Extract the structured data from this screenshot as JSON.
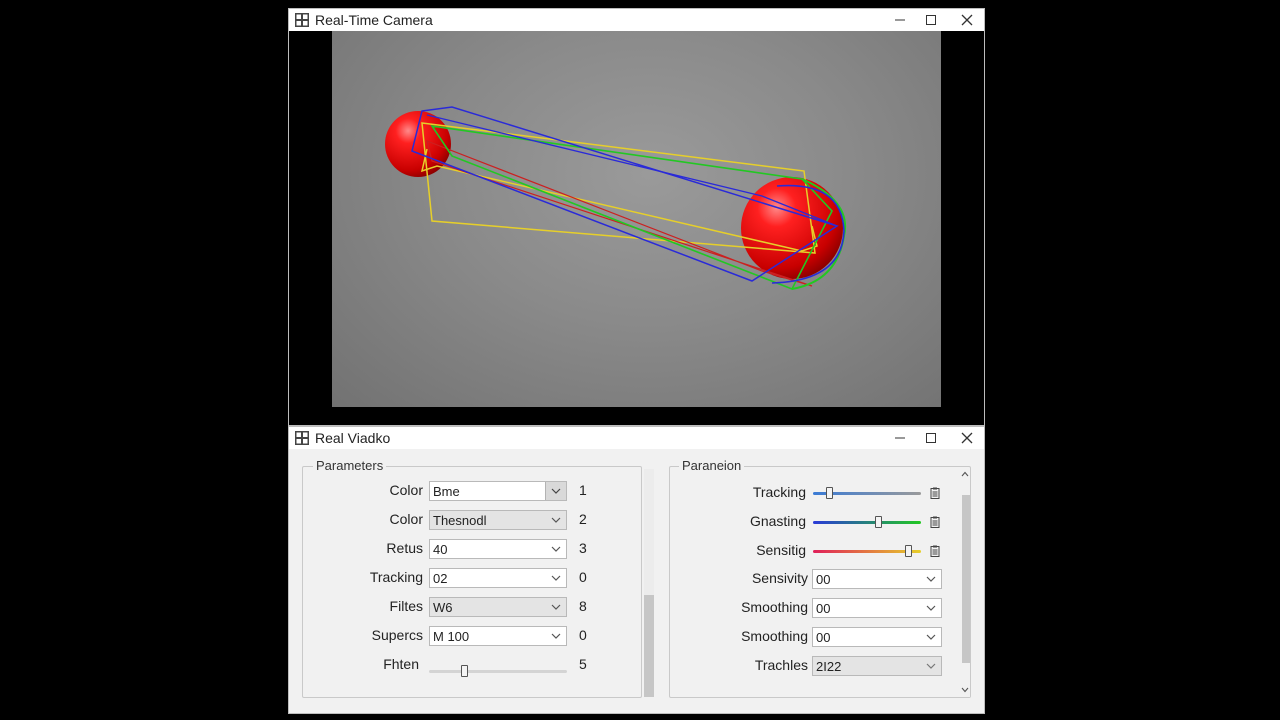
{
  "camera_window": {
    "title": "Real-Time Camera",
    "icon": "app-grid-icon"
  },
  "control_window": {
    "title": "Real Viadko",
    "icon": "app-grid-icon"
  },
  "window_controls": {
    "minimize": "minimize-icon",
    "maximize": "maximize-icon",
    "close": "close-icon"
  },
  "colors": {
    "ball": "#e00a0a",
    "box_blue": "#2a2ad8",
    "box_green": "#22c822",
    "box_yellow": "#e6cf2a",
    "box_red": "#cc2020"
  },
  "parameters_group": {
    "legend": "Parameters",
    "rows": [
      {
        "label": "Color",
        "value": "Bme",
        "number": "1",
        "arrow_boxed": true
      },
      {
        "label": "Color",
        "value": "Thesnodl",
        "number": "2",
        "disabled": true
      },
      {
        "label": "Retus",
        "value": "40",
        "number": "3"
      },
      {
        "label": "Tracking",
        "value": "02",
        "number": "0"
      },
      {
        "label": "Filtes",
        "value": "W6",
        "number": "8",
        "disabled": true
      },
      {
        "label": "Supercs",
        "value": "M 100",
        "number": "0"
      }
    ],
    "slider_row": {
      "label": "Fhten",
      "number": "5",
      "level": 0.25
    }
  },
  "paraneion_group": {
    "legend": "Paraneion",
    "sliders": [
      {
        "label": "Tracking",
        "level": 0.15
      },
      {
        "label": "Gnasting",
        "level": 0.6
      },
      {
        "label": "Sensitig",
        "level": 0.88
      }
    ],
    "dropdowns": [
      {
        "label": "Sensivity",
        "value": "00"
      },
      {
        "label": "Smoothing",
        "value": "00"
      },
      {
        "label": "Smoothing",
        "value": "00"
      },
      {
        "label": "Trachles",
        "value": "2I22",
        "disabled": true
      }
    ]
  }
}
